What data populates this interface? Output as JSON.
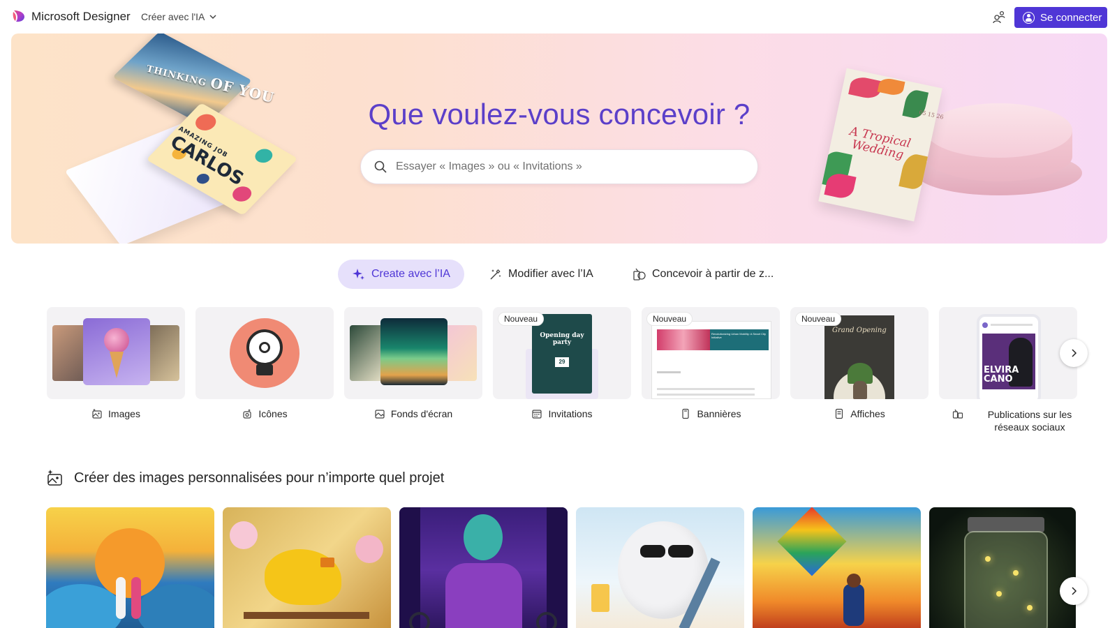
{
  "header": {
    "brand": "Microsoft Designer",
    "create_menu_label": "Créer avec l'IA",
    "signin_label": "Se connecter"
  },
  "hero": {
    "title": "Que voulez-vous concevoir ?",
    "search_placeholder": "Essayer « Images » ou « Invitations »",
    "card1_line1": "THINKING",
    "card1_line2": "OF YOU",
    "card2_line1": "AMAZING JOB",
    "card2_line2": "CARLOS",
    "card3_title": "A Tropical Wedding",
    "card3_date": "05 15 26"
  },
  "tabs": [
    {
      "label": "Create avec l’IA",
      "icon": "sparkle-icon",
      "active": true
    },
    {
      "label": "Modifier avec l’IA",
      "icon": "magic-wand-icon",
      "active": false
    },
    {
      "label": "Concevoir à partir de z...",
      "icon": "design-shapes-icon",
      "active": false
    }
  ],
  "categories": [
    {
      "label": "Images",
      "icon": "image-sparkle-icon",
      "badge": ""
    },
    {
      "label": "Icônes",
      "icon": "icons-icon",
      "badge": ""
    },
    {
      "label": "Fonds d'écran",
      "icon": "wallpaper-icon",
      "badge": ""
    },
    {
      "label": "Invitations",
      "icon": "calendar-icon",
      "badge": "Nouveau",
      "card_text": "Opening day party",
      "card_date": "29"
    },
    {
      "label": "Bannières",
      "icon": "banner-icon",
      "badge": "Nouveau",
      "card_text": "Revolutionizing Urban Mobility: A Smart City Initiative"
    },
    {
      "label": "Affiches",
      "icon": "poster-icon",
      "badge": "Nouveau",
      "card_text": "Grand Opening"
    },
    {
      "label": "Publications sur les réseaux sociaux",
      "icon": "social-post-icon",
      "badge": "",
      "card_text_1": "ELVIRA",
      "card_text_2": "CANO"
    }
  ],
  "section": {
    "title": "Créer des images personnalisées pour n’importe quel projet",
    "icon": "image-sparkle-icon"
  },
  "gallery": [
    {
      "subject": "paper-art-couple-sunset"
    },
    {
      "subject": "yellow-canary-blossoms"
    },
    {
      "subject": "gymnast-rings"
    },
    {
      "subject": "yeti-sunglasses-beach"
    },
    {
      "subject": "kite-runner-polygon"
    },
    {
      "subject": "firefly-jar"
    }
  ],
  "colors": {
    "accent": "#4f36d6",
    "hero_title": "#5b3fc9",
    "active_tab_bg": "#e6e0fb"
  }
}
